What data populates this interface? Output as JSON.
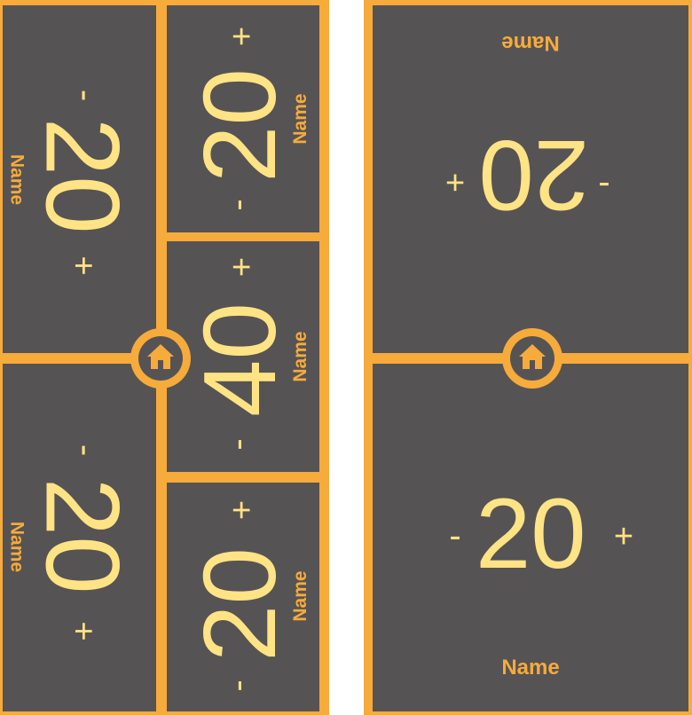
{
  "colors": {
    "accent": "#f6ab3b",
    "panel": "#565355",
    "life_text": "#ffe384"
  },
  "minus_label": "-",
  "plus_label": "+",
  "home_icon": "home-icon",
  "left_board": {
    "players": [
      {
        "name": "Name",
        "life": "20",
        "position": "top-left"
      },
      {
        "name": "Name",
        "life": "20",
        "position": "top-right"
      },
      {
        "name": "Name",
        "life": "40",
        "position": "middle-right"
      },
      {
        "name": "Name",
        "life": "20",
        "position": "bottom-left"
      },
      {
        "name": "Name",
        "life": "20",
        "position": "bottom-right"
      }
    ]
  },
  "right_board": {
    "players": [
      {
        "name": "Name",
        "life": "20",
        "position": "top"
      },
      {
        "name": "Name",
        "life": "20",
        "position": "bottom"
      }
    ]
  }
}
